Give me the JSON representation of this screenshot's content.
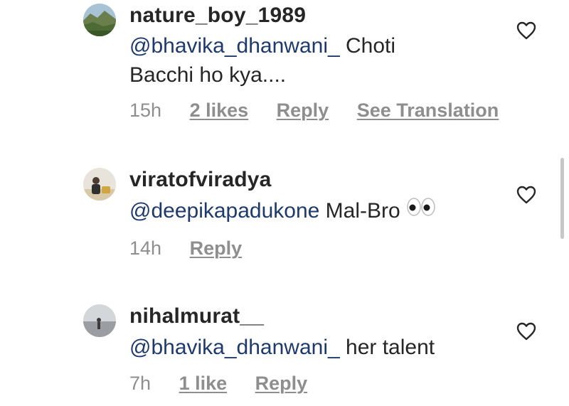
{
  "comments": [
    {
      "username": "nature_boy_1989",
      "mention": "@bhavika_dhanwani_",
      "text_line1_after_mention": " Choti",
      "text_line2": "Bacchi ho kya....",
      "time": "15h",
      "likes": "2 likes",
      "reply": "Reply",
      "translate": "See Translation"
    },
    {
      "username": "viratofviradya",
      "mention": "@deepikapadukone",
      "text_after_mention": " Mal-Bro ",
      "emoji": "👀",
      "time": "14h",
      "reply": "Reply"
    },
    {
      "username": "nihalmurat__",
      "mention": "@bhavika_dhanwani_",
      "text_after_mention": " her talent",
      "time": "7h",
      "likes": "1 like",
      "reply": "Reply"
    }
  ],
  "colors": {
    "text": "#262626",
    "mention": "#1e3a6d",
    "meta": "#8e8e8e",
    "scrollbar": "#c7c7c7"
  },
  "icons": {
    "like": "heart-outline-icon"
  }
}
